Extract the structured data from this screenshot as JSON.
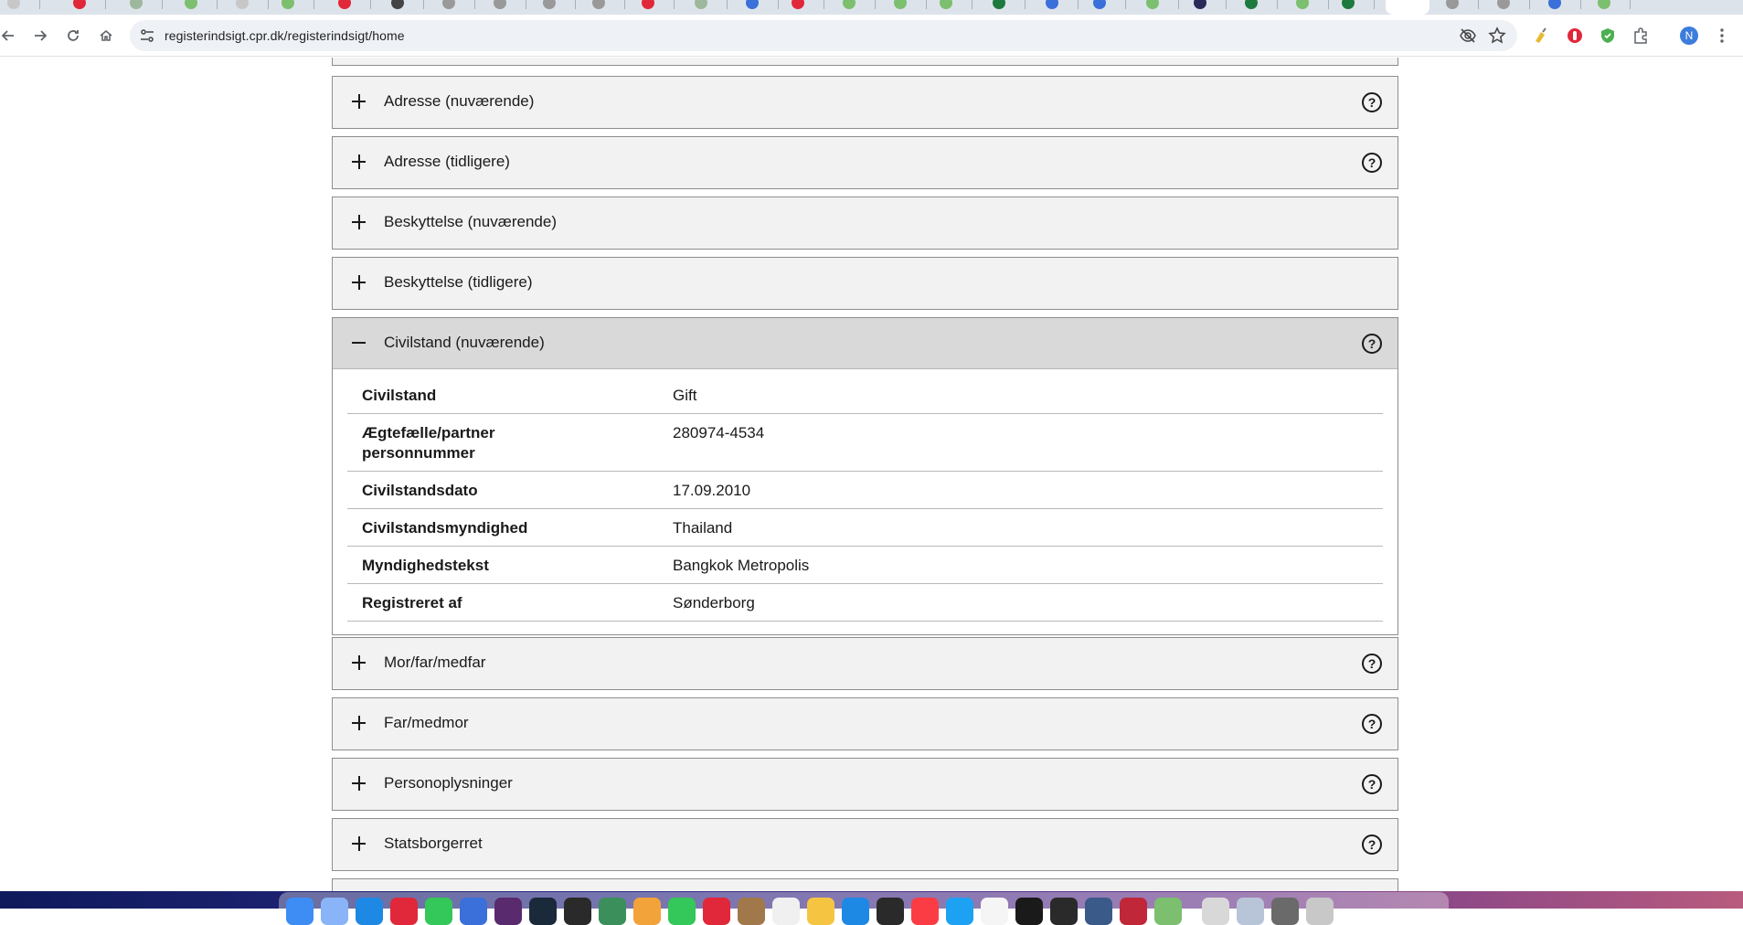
{
  "browser": {
    "url": "registerindsigt.cpr.dk/registerindsigt/home",
    "avatar_letter": "N"
  },
  "sections": [
    {
      "title": "Adresse (nuværende)",
      "expanded": false,
      "help": true
    },
    {
      "title": "Adresse (tidligere)",
      "expanded": false,
      "help": true
    },
    {
      "title": "Beskyttelse (nuværende)",
      "expanded": false,
      "help": false
    },
    {
      "title": "Beskyttelse (tidligere)",
      "expanded": false,
      "help": false
    },
    {
      "title": "Civilstand (nuværende)",
      "expanded": true,
      "help": true
    },
    {
      "title": "Mor/far/medfar",
      "expanded": false,
      "help": true
    },
    {
      "title": "Far/medmor",
      "expanded": false,
      "help": true
    },
    {
      "title": "Personoplysninger",
      "expanded": false,
      "help": true
    },
    {
      "title": "Statsborgerret",
      "expanded": false,
      "help": true
    }
  ],
  "civilstand": {
    "rows": [
      {
        "label": "Civilstand",
        "value": "Gift"
      },
      {
        "label": "Ægtefælle/partner personnummer",
        "value": "280974-4534"
      },
      {
        "label": "Civilstandsdato",
        "value": "17.09.2010"
      },
      {
        "label": "Civilstandsmyndighed",
        "value": "Thailand"
      },
      {
        "label": "Myndighedstekst",
        "value": "Bangkok Metropolis"
      },
      {
        "label": "Registreret af",
        "value": "Sønderborg"
      }
    ]
  },
  "icons": {
    "help": "?",
    "toggle_collapsed": "plus-icon",
    "toggle_expanded": "minus-icon"
  },
  "colors": {
    "section_bg": "#f2f2f2",
    "section_open_bg": "#d9d9d9",
    "border": "#8d8d8d",
    "avatar": "#3b7ddd"
  }
}
